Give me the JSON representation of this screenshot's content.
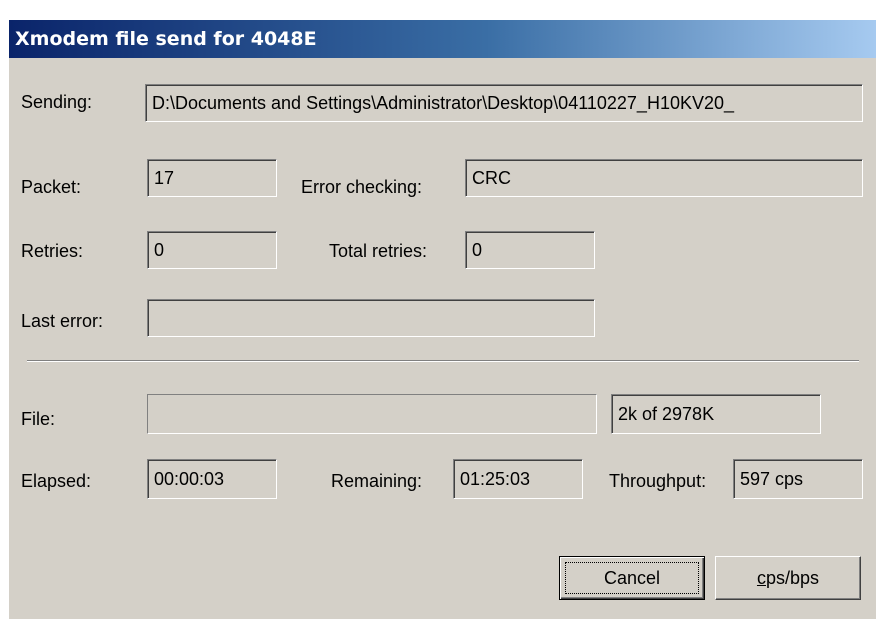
{
  "window": {
    "title": "Xmodem file send for 4048E"
  },
  "labels": {
    "sending": "Sending:",
    "packet": "Packet:",
    "error_checking": "Error checking:",
    "retries": "Retries:",
    "total_retries": "Total retries:",
    "last_error": "Last error:",
    "file": "File:",
    "elapsed": "Elapsed:",
    "remaining": "Remaining:",
    "throughput": "Throughput:"
  },
  "values": {
    "sending": "D:\\Documents and Settings\\Administrator\\Desktop\\04110227_H10KV20_",
    "packet": "17",
    "error_checking": "CRC",
    "retries": "0",
    "total_retries": "0",
    "last_error": "",
    "file_size": "2k of 2978K",
    "elapsed": "00:00:03",
    "remaining": "01:25:03",
    "throughput": "597 cps"
  },
  "progress": {
    "fraction": 0.0
  },
  "buttons": {
    "cancel": "Cancel",
    "cps_bps_mnemonic": "c",
    "cps_bps_rest": "ps/bps"
  },
  "colors": {
    "titlebar_start": "#0a246a",
    "titlebar_end": "#a6caf0",
    "face": "#d4d0c8"
  }
}
